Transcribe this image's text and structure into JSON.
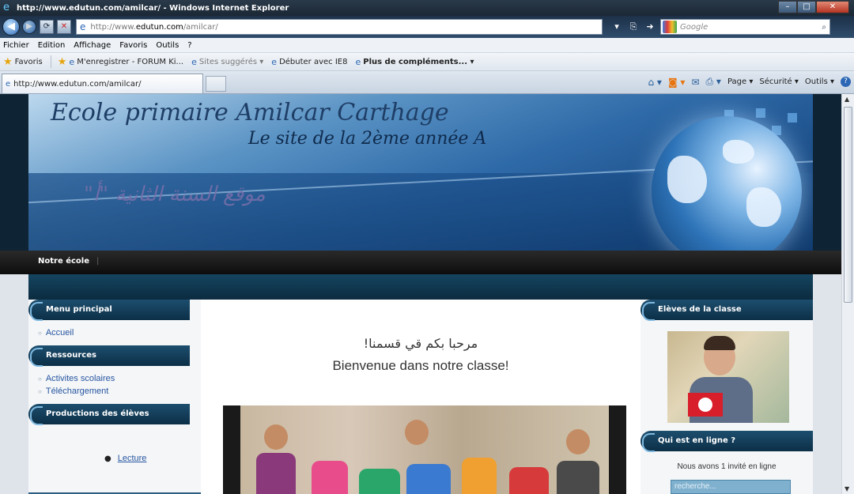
{
  "browser": {
    "window_title": "http://www.edutun.com/amilcar/ - Windows Internet Explorer",
    "url_prefix": "http://www.",
    "url_domain": "edutun.com",
    "url_path": "/amilcar/",
    "search_placeholder": "Google",
    "menu": [
      "Fichier",
      "Edition",
      "Affichage",
      "Favoris",
      "Outils",
      "?"
    ],
    "favorites": {
      "label": "Favoris",
      "items": [
        "M'enregistrer - FORUM Ki...",
        "Sites suggérés ▾",
        "Débuter avec IE8",
        "Plus de compléments... ▾"
      ]
    },
    "tab_title": "http://www.edutun.com/amilcar/",
    "commands": {
      "page": "Page ▾",
      "security": "Sécurité ▾",
      "tools": "Outils ▾"
    }
  },
  "site": {
    "title": "Ecole primaire Amilcar Carthage",
    "subtitle": "Le site de la 2ème année A",
    "arabic_title": "موقع السنة الثانية \"أ\"",
    "nav": [
      "Notre école"
    ]
  },
  "left": {
    "menu_principal": {
      "title": "Menu principal",
      "items": [
        "Accueil"
      ]
    },
    "ressources": {
      "title": "Ressources",
      "items": [
        "Activites scolaires",
        "Téléchargement"
      ]
    },
    "productions": {
      "title": "Productions des élèves",
      "items": [
        "Lecture"
      ]
    }
  },
  "center": {
    "welcome_ar": "مرحبا بكم قي قسمنا!",
    "welcome_fr": "Bienvenue dans notre classe!"
  },
  "right": {
    "eleves_title": "Elèves de la classe",
    "online_title": "Qui est en ligne ?",
    "online_text": "Nous avons 1 invité en ligne",
    "search_placeholder": "recherche..."
  },
  "colors": {
    "nav_dark": "#0c2f47",
    "link": "#2856a0",
    "banner_blue": "#2f6aa8"
  }
}
